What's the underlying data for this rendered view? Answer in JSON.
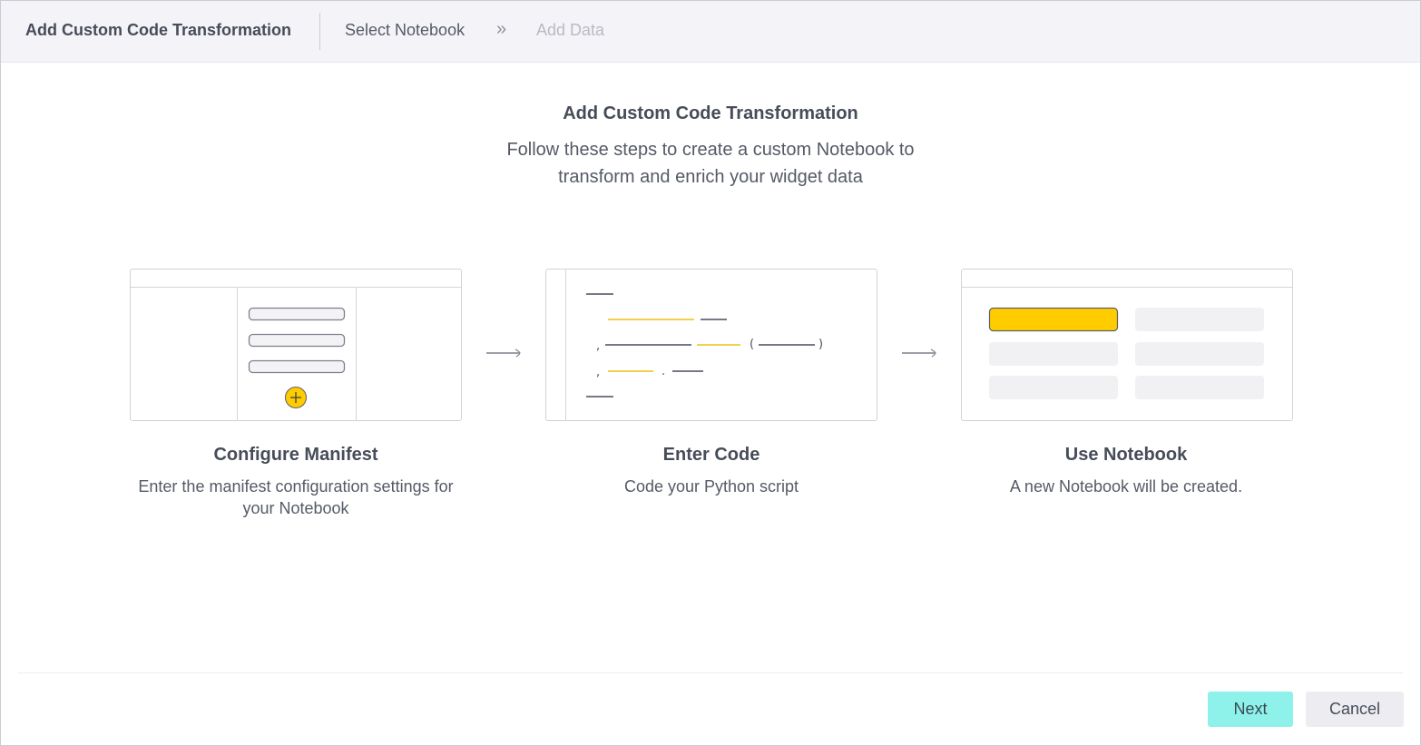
{
  "header": {
    "title": "Add Custom Code Transformation",
    "breadcrumb": {
      "current": "Select Notebook",
      "separator": "»",
      "next": "Add Data"
    }
  },
  "intro": {
    "title": "Add Custom Code Transformation",
    "subtitle": "Follow these steps to create a custom Notebook to transform and enrich your widget data"
  },
  "steps": [
    {
      "title": "Configure Manifest",
      "description": "Enter the manifest configuration settings for your Notebook",
      "illustration": "manifest-form-illustration"
    },
    {
      "title": "Enter Code",
      "description": "Code your Python script",
      "illustration": "code-editor-illustration"
    },
    {
      "title": "Use Notebook",
      "description": "A new Notebook will be created.",
      "illustration": "notebook-grid-illustration"
    }
  ],
  "footer": {
    "next_label": "Next",
    "cancel_label": "Cancel"
  },
  "colors": {
    "accent_yellow": "#ffcc00",
    "next_button": "#8ef1ea",
    "header_bg": "#f4f4f8"
  }
}
